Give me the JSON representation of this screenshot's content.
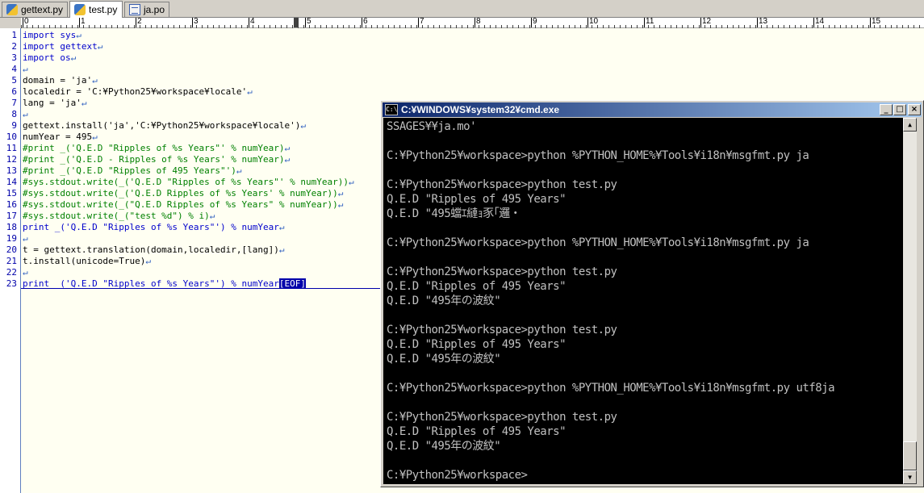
{
  "tabs": [
    {
      "label": "gettext.py",
      "icon": "python-file-icon"
    },
    {
      "label": "test.py",
      "icon": "python-file-icon",
      "active": true
    },
    {
      "label": "ja.po",
      "icon": "po-file-icon"
    }
  ],
  "ruler": {
    "labels": [
      "0",
      "1",
      "2",
      "3",
      "4",
      "5",
      "6",
      "7",
      "8",
      "9",
      "10",
      "11",
      "12",
      "13",
      "14",
      "15"
    ]
  },
  "editor": {
    "line_numbers": [
      "1",
      "2",
      "3",
      "4",
      "5",
      "6",
      "7",
      "8",
      "9",
      "10",
      "11",
      "12",
      "13",
      "14",
      "15",
      "16",
      "17",
      "18",
      "19",
      "20",
      "21",
      "22",
      "23"
    ],
    "lines": [
      "import sys",
      "import gettext",
      "import os",
      "",
      "domain = 'ja'",
      "localedir = 'C:¥Python25¥workspace¥locale'",
      "lang = 'ja'",
      "",
      "gettext.install('ja','C:¥Python25¥workspace¥locale')",
      "numYear = 495",
      "#print _('Q.E.D \"Ripples of %s Years\"' % numYear)",
      "#print _('Q.E.D - Ripples of %s Years' % numYear)",
      "#print _('Q.E.D \"Ripples of 495 Years\"')",
      "#sys.stdout.write(_('Q.E.D \"Ripples of %s Years\"' % numYear))",
      "#sys.stdout.write(_('Q.E.D Ripples of %s Years' % numYear))",
      "#sys.stdout.write(_(\"Q.E.D Ripples of %s Years\" % numYear))",
      "#sys.stdout.write(_(\"test %d\") % i)",
      "print _('Q.E.D \"Ripples of %s Years\"') % numYear",
      "",
      "t = gettext.translation(domain,localedir,[lang])",
      "t.install(unicode=True)",
      "",
      "print _('Q.E.D \"Ripples of %s Years\"') % numYear"
    ],
    "eol_marker": "↵",
    "eof_marker": "[EOF]"
  },
  "cmd": {
    "title": "C:¥WINDOWS¥system32¥cmd.exe",
    "icon_text": "C:\\",
    "buttons": {
      "minimize": "_",
      "maximize": "□",
      "close": "×"
    },
    "lines": [
      "SSAGES¥¥ja.mo'",
      "",
      "C:¥Python25¥workspace>python %PYTHON_HOME%¥Tools¥i18n¥msgfmt.py ja",
      "",
      "C:¥Python25¥workspace>python test.py",
      "Q.E.D \"Ripples of 495 Years\"",
      "Q.E.D \"495蟷ｴ縺ｮ豕｢邏・",
      "",
      "C:¥Python25¥workspace>python %PYTHON_HOME%¥Tools¥i18n¥msgfmt.py ja",
      "",
      "C:¥Python25¥workspace>python test.py",
      "Q.E.D \"Ripples of 495 Years\"",
      "Q.E.D \"495年の波紋\"",
      "",
      "C:¥Python25¥workspace>python test.py",
      "Q.E.D \"Ripples of 495 Years\"",
      "Q.E.D \"495年の波紋\"",
      "",
      "C:¥Python25¥workspace>python %PYTHON_HOME%¥Tools¥i18n¥msgfmt.py utf8ja",
      "",
      "C:¥Python25¥workspace>python test.py",
      "Q.E.D \"Ripples of 495 Years\"",
      "Q.E.D \"495年の波紋\"",
      "",
      "C:¥Python25¥workspace>"
    ],
    "scroll_up": "▲",
    "scroll_down": "▼"
  }
}
